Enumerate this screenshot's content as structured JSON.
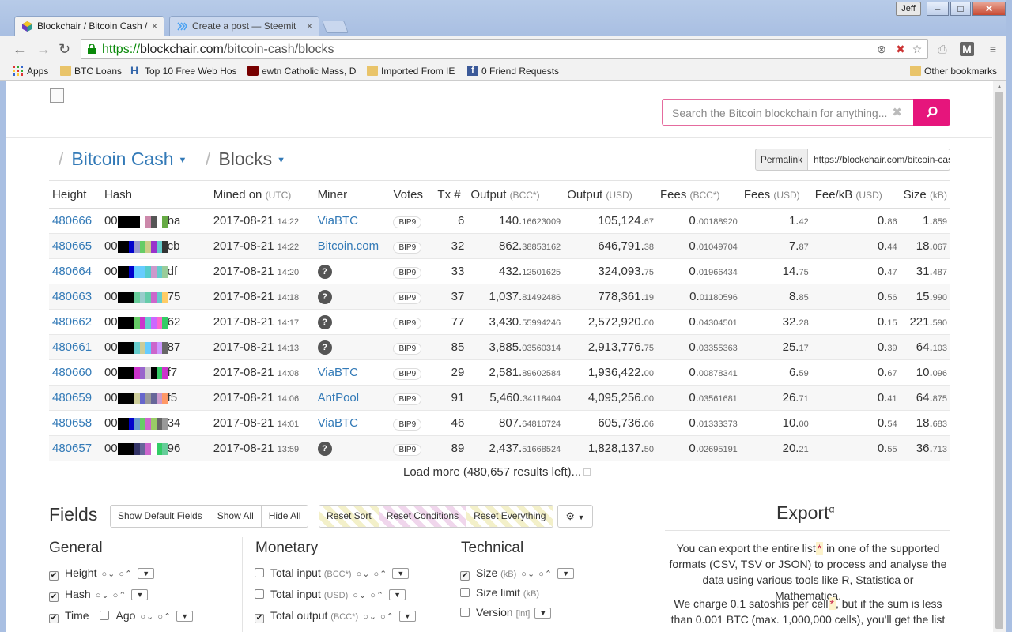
{
  "browser": {
    "tabs": [
      {
        "title": "Blockchair / Bitcoin Cash /",
        "close": "×"
      },
      {
        "title": "Create a post — Steemit",
        "close": "×"
      }
    ],
    "user": "Jeff",
    "window_buttons": {
      "minimize": "–",
      "maximize": "□",
      "close": "✕"
    },
    "url_scheme": "https://",
    "url_host": "blockchair.com",
    "url_path": "/bitcoin-cash/blocks",
    "bookmarks": [
      "Apps",
      "BTC Loans",
      "Top 10 Free Web Hos",
      "ewtn Catholic Mass, D",
      "Imported From IE",
      "0 Friend Requests"
    ],
    "other_bookmarks": "Other bookmarks"
  },
  "search": {
    "placeholder": "Search the Bitcoin blockchain for anything..."
  },
  "breadcrumb": {
    "chain": "Bitcoin Cash",
    "section": "Blocks"
  },
  "permalink": {
    "label": "Permalink",
    "url": "https://blockchair.com/bitcoin-cash/blocks"
  },
  "table": {
    "headers": {
      "height": "Height",
      "hash": "Hash",
      "mined": "Mined on",
      "mined_unit": "(UTC)",
      "miner": "Miner",
      "votes": "Votes",
      "tx": "Tx #",
      "output_bcc": "Output",
      "output_bcc_unit": "(BCC*)",
      "output_usd": "Output",
      "output_usd_unit": "(USD)",
      "fees_bcc": "Fees",
      "fees_bcc_unit": "(BCC*)",
      "fees_usd": "Fees",
      "fees_usd_unit": "(USD)",
      "feekb": "Fee/kB",
      "feekb_unit": "(USD)",
      "size": "Size",
      "size_unit": "(kB)"
    },
    "rows": [
      {
        "height": "480666",
        "hash_pre": "00",
        "hash_post": "ba",
        "hash_colors": [
          "#000",
          "#000",
          "#000",
          "#000",
          "#fff",
          "#c8a",
          "#555",
          "#fff",
          "#6a4"
        ],
        "date": "2017-08-21",
        "time": "14:22",
        "miner": "ViaBTC",
        "vote": "BIP9",
        "tx": "6",
        "out_bcc_i": "140.",
        "out_bcc_f": "16623009",
        "out_usd_i": "105,124.",
        "out_usd_f": "67",
        "fee_bcc_i": "0.",
        "fee_bcc_f": "00188920",
        "fee_usd_i": "1.",
        "fee_usd_f": "42",
        "feekb_i": "0.",
        "feekb_f": "86",
        "size_i": "1.",
        "size_f": "859"
      },
      {
        "height": "480665",
        "hash_pre": "00",
        "hash_post": "cb",
        "hash_colors": [
          "#000",
          "#000",
          "#00c",
          "#99c",
          "#6c6",
          "#cc8",
          "#93c",
          "#6cc",
          "#333"
        ],
        "date": "2017-08-21",
        "time": "14:22",
        "miner": "Bitcoin.com",
        "vote": "BIP9",
        "tx": "32",
        "out_bcc_i": "862.",
        "out_bcc_f": "38853162",
        "out_usd_i": "646,791.",
        "out_usd_f": "38",
        "fee_bcc_i": "0.",
        "fee_bcc_f": "01049704",
        "fee_usd_i": "7.",
        "fee_usd_f": "87",
        "feekb_i": "0.",
        "feekb_f": "44",
        "size_i": "18.",
        "size_f": "067"
      },
      {
        "height": "480664",
        "hash_pre": "00",
        "hash_post": "df",
        "hash_colors": [
          "#000",
          "#000",
          "#00c",
          "#6cf",
          "#6cf",
          "#5cc",
          "#c9c",
          "#6cc",
          "#9c9"
        ],
        "date": "2017-08-21",
        "time": "14:20",
        "miner": "?",
        "vote": "BIP9",
        "tx": "33",
        "out_bcc_i": "432.",
        "out_bcc_f": "12501625",
        "out_usd_i": "324,093.",
        "out_usd_f": "75",
        "fee_bcc_i": "0.",
        "fee_bcc_f": "01966434",
        "fee_usd_i": "14.",
        "fee_usd_f": "75",
        "feekb_i": "0.",
        "feekb_f": "47",
        "size_i": "31.",
        "size_f": "487"
      },
      {
        "height": "480663",
        "hash_pre": "00",
        "hash_post": "75",
        "hash_colors": [
          "#000",
          "#000",
          "#000",
          "#6c9",
          "#9cc",
          "#6ca",
          "#c6c",
          "#6cc",
          "#fc6"
        ],
        "date": "2017-08-21",
        "time": "14:18",
        "miner": "?",
        "vote": "BIP9",
        "tx": "37",
        "out_bcc_i": "1,037.",
        "out_bcc_f": "81492486",
        "out_usd_i": "778,361.",
        "out_usd_f": "19",
        "fee_bcc_i": "0.",
        "fee_bcc_f": "01180596",
        "fee_usd_i": "8.",
        "fee_usd_f": "85",
        "feekb_i": "0.",
        "feekb_f": "56",
        "size_i": "15.",
        "size_f": "990"
      },
      {
        "height": "480662",
        "hash_pre": "00",
        "hash_post": "62",
        "hash_colors": [
          "#000",
          "#000",
          "#000",
          "#6c6",
          "#c3c",
          "#6cc",
          "#c6f",
          "#f6c",
          "#3c6"
        ],
        "date": "2017-08-21",
        "time": "14:17",
        "miner": "?",
        "vote": "BIP9",
        "tx": "77",
        "out_bcc_i": "3,430.",
        "out_bcc_f": "55994246",
        "out_usd_i": "2,572,920.",
        "out_usd_f": "00",
        "fee_bcc_i": "0.",
        "fee_bcc_f": "04304501",
        "fee_usd_i": "32.",
        "fee_usd_f": "28",
        "feekb_i": "0.",
        "feekb_f": "15",
        "size_i": "221.",
        "size_f": "590"
      },
      {
        "height": "480661",
        "hash_pre": "00",
        "hash_post": "87",
        "hash_colors": [
          "#000",
          "#000",
          "#000",
          "#6cc",
          "#cc9",
          "#6cf",
          "#c6c",
          "#c9f",
          "#666"
        ],
        "date": "2017-08-21",
        "time": "14:13",
        "miner": "?",
        "vote": "BIP9",
        "tx": "85",
        "out_bcc_i": "3,885.",
        "out_bcc_f": "03560314",
        "out_usd_i": "2,913,776.",
        "out_usd_f": "75",
        "fee_bcc_i": "0.",
        "fee_bcc_f": "03355363",
        "fee_usd_i": "25.",
        "fee_usd_f": "17",
        "feekb_i": "0.",
        "feekb_f": "39",
        "size_i": "64.",
        "size_f": "103"
      },
      {
        "height": "480660",
        "hash_pre": "00",
        "hash_post": "f7",
        "hash_colors": [
          "#000",
          "#000",
          "#000",
          "#c3c",
          "#96c",
          "#ccc",
          "#000",
          "#3c6",
          "#c3c"
        ],
        "date": "2017-08-21",
        "time": "14:08",
        "miner": "ViaBTC",
        "vote": "BIP9",
        "tx": "29",
        "out_bcc_i": "2,581.",
        "out_bcc_f": "89602584",
        "out_usd_i": "1,936,422.",
        "out_usd_f": "00",
        "fee_bcc_i": "0.",
        "fee_bcc_f": "00878341",
        "fee_usd_i": "6.",
        "fee_usd_f": "59",
        "feekb_i": "0.",
        "feekb_f": "67",
        "size_i": "10.",
        "size_f": "096"
      },
      {
        "height": "480659",
        "hash_pre": "00",
        "hash_post": "f5",
        "hash_colors": [
          "#000",
          "#000",
          "#000",
          "#cc9",
          "#66c",
          "#999",
          "#669",
          "#c9c",
          "#f96"
        ],
        "date": "2017-08-21",
        "time": "14:06",
        "miner": "AntPool",
        "vote": "BIP9",
        "tx": "91",
        "out_bcc_i": "5,460.",
        "out_bcc_f": "34118404",
        "out_usd_i": "4,095,256.",
        "out_usd_f": "00",
        "fee_bcc_i": "0.",
        "fee_bcc_f": "03561681",
        "fee_usd_i": "26.",
        "fee_usd_f": "71",
        "feekb_i": "0.",
        "feekb_f": "41",
        "size_i": "64.",
        "size_f": "875"
      },
      {
        "height": "480658",
        "hash_pre": "00",
        "hash_post": "34",
        "hash_colors": [
          "#000",
          "#000",
          "#00c",
          "#69c",
          "#6c6",
          "#c6c",
          "#9c6",
          "#666",
          "#999"
        ],
        "date": "2017-08-21",
        "time": "14:01",
        "miner": "ViaBTC",
        "vote": "BIP9",
        "tx": "46",
        "out_bcc_i": "807.",
        "out_bcc_f": "64810724",
        "out_usd_i": "605,736.",
        "out_usd_f": "06",
        "fee_bcc_i": "0.",
        "fee_bcc_f": "01333373",
        "fee_usd_i": "10.",
        "fee_usd_f": "00",
        "feekb_i": "0.",
        "feekb_f": "54",
        "size_i": "18.",
        "size_f": "683"
      },
      {
        "height": "480657",
        "hash_pre": "00",
        "hash_post": "96",
        "hash_colors": [
          "#000",
          "#000",
          "#000",
          "#336",
          "#669",
          "#c6c",
          "#fff",
          "#3c6",
          "#6c9"
        ],
        "date": "2017-08-21",
        "time": "13:59",
        "miner": "?",
        "vote": "BIP9",
        "tx": "89",
        "out_bcc_i": "2,437.",
        "out_bcc_f": "51668524",
        "out_usd_i": "1,828,137.",
        "out_usd_f": "50",
        "fee_bcc_i": "0.",
        "fee_bcc_f": "02695191",
        "fee_usd_i": "20.",
        "fee_usd_f": "21",
        "feekb_i": "0.",
        "feekb_f": "55",
        "size_i": "36.",
        "size_f": "713"
      }
    ]
  },
  "load_more": "Load more (480,657 results left)...",
  "fields": {
    "title": "Fields",
    "buttons": [
      "Show Default Fields",
      "Show All",
      "Hide All"
    ],
    "reset_buttons": [
      "Reset Sort",
      "Reset Conditions",
      "Reset Everything"
    ],
    "gear": "⚙",
    "general": {
      "title": "General",
      "items": [
        "Height",
        "Hash",
        "Time",
        "Ago"
      ]
    },
    "monetary": {
      "title": "Monetary",
      "items": [
        "Total input",
        "Total input",
        "Total output"
      ],
      "units": [
        "(BCC*)",
        "(USD)",
        "(BCC*)"
      ]
    },
    "technical": {
      "title": "Technical",
      "items": [
        "Size",
        "Size limit",
        "Version"
      ],
      "units": [
        "(kB)",
        "(kB)",
        "[int]"
      ]
    }
  },
  "export": {
    "title": "Export",
    "sup": "α",
    "p1_a": "You can export the entire list",
    "p1_b": " in one of the supported formats (CSV, TSV or JSON) to process and analyse the data using various tools like R, Statistica or Mathematica.",
    "p2_a": "We charge 0.1 satoshis per cell",
    "p2_b": ", but if the sum is less than 0.001 BTC (max. 1,000,000 cells), you'll get the list",
    "star": "*"
  },
  "colors": {
    "link": "#337ab7",
    "accent": "#e6157c",
    "search_border": "#e56b9e"
  }
}
